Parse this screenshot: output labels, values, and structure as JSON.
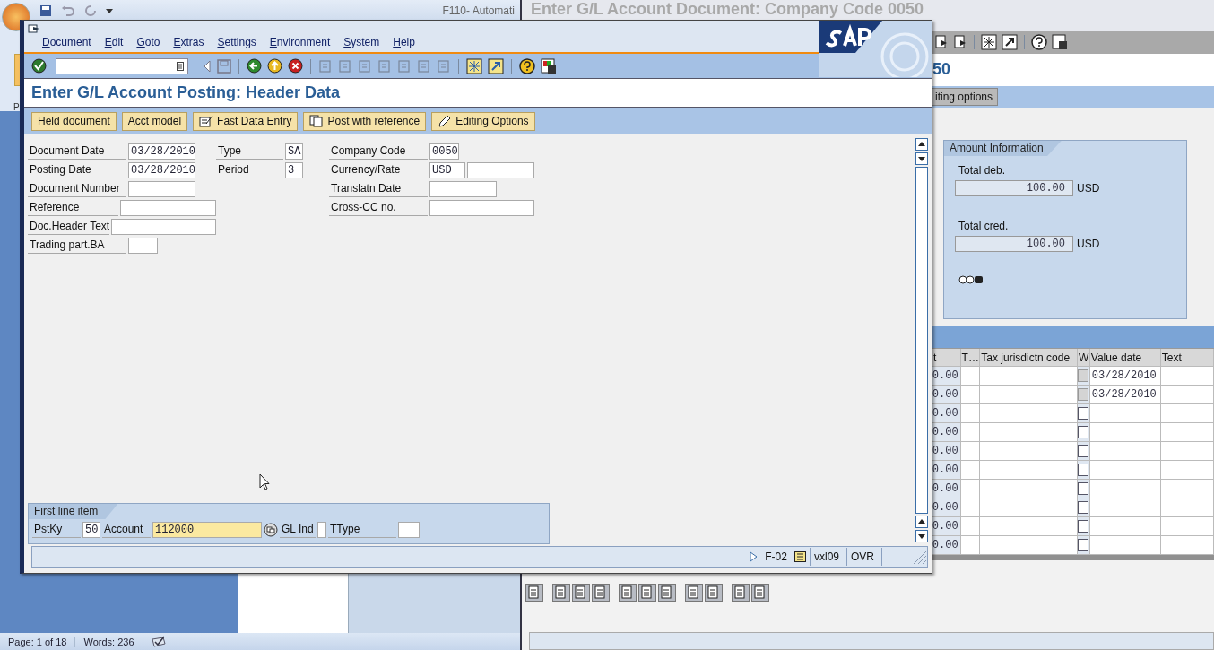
{
  "word": {
    "title": "F110- Automati",
    "ribbon_letter": "P",
    "status_bar": [
      "Page: 1 of 18",
      "Words: 236"
    ]
  },
  "background_window": {
    "title": "Enter G/L Account Document: Company Code 0050",
    "header_fragment": "50",
    "button": "iting options",
    "amount_information": {
      "title": "Amount Information",
      "fields": [
        {
          "label": "Total deb.",
          "value": "100.00",
          "currency": "USD"
        },
        {
          "label": "Total cred.",
          "value": "100.00",
          "currency": "USD"
        }
      ]
    },
    "table": {
      "columns": [
        "t",
        "T…",
        "Tax jurisdictn code",
        "W",
        "Value date",
        "Text"
      ],
      "rows": [
        {
          "amount": "0.00",
          "disabled": true,
          "value_date": "03/28/2010"
        },
        {
          "amount": "0.00",
          "disabled": true,
          "value_date": "03/28/2010"
        },
        {
          "amount": "0.00",
          "disabled": false
        },
        {
          "amount": "0.00",
          "disabled": false
        },
        {
          "amount": "0.00",
          "disabled": false
        },
        {
          "amount": "0.00",
          "disabled": false
        },
        {
          "amount": "0.00",
          "disabled": false
        },
        {
          "amount": "0.00",
          "disabled": false
        },
        {
          "amount": "0.00",
          "disabled": false
        },
        {
          "amount": "0.00",
          "disabled": false
        }
      ]
    }
  },
  "dialog": {
    "menu": [
      "Document",
      "Edit",
      "Goto",
      "Extras",
      "Settings",
      "Environment",
      "System",
      "Help"
    ],
    "title": "Enter G/L Account Posting: Header Data",
    "buttons": [
      "Held document",
      "Acct model",
      "Fast Data Entry",
      "Post with reference",
      "Editing Options"
    ],
    "columns": [
      [
        {
          "label": "Document Date",
          "value": "03/28/2010"
        },
        {
          "label": "Posting Date",
          "value": "03/28/2010"
        },
        {
          "label": "Document Number"
        },
        {
          "label": "Reference"
        },
        {
          "label": "Doc.Header Text"
        },
        {
          "label": "Trading part.BA"
        }
      ],
      [
        {
          "label": "Type",
          "value": "SA"
        },
        {
          "label": "Period",
          "value": "3"
        }
      ],
      [
        {
          "label": "Company Code",
          "value": "0050"
        },
        {
          "label": "Currency/Rate",
          "value": "USD"
        },
        {
          "label": "Translatn Date"
        },
        {
          "label": "Cross-CC no."
        }
      ]
    ],
    "first_line_item": {
      "title": "First line item",
      "pstky_label": "PstKy",
      "pstky": "50",
      "account_label": "Account",
      "account": "112000",
      "gl_ind_label": "GL Ind",
      "ttype_label": "TType"
    },
    "status_bar": [
      "F-02",
      "vxl09",
      "OVR"
    ]
  }
}
